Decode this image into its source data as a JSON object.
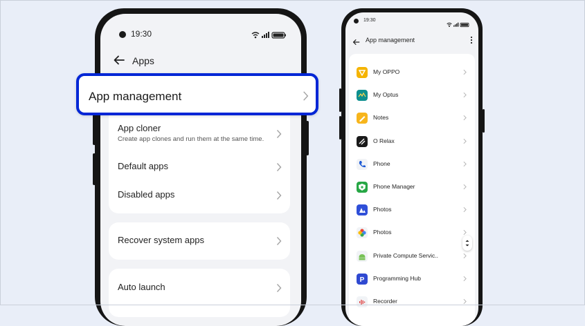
{
  "left_phone": {
    "status": {
      "time": "19:30"
    },
    "header": {
      "title": "Apps"
    },
    "highlighted_item": {
      "label": "App management"
    },
    "group1": [
      {
        "label": "App cloner",
        "sub": "Create app clones and run them at the same time."
      },
      {
        "label": "Default apps"
      },
      {
        "label": "Disabled apps"
      }
    ],
    "group2": [
      {
        "label": "Recover system apps"
      }
    ],
    "group3": [
      {
        "label": "Auto launch"
      }
    ]
  },
  "right_phone": {
    "status": {
      "time": "19:30"
    },
    "header": {
      "title": "App management"
    },
    "apps": [
      {
        "name": "My OPPO",
        "icon": "my-oppo-icon",
        "color": "#f5b400"
      },
      {
        "name": "My Optus",
        "icon": "my-optus-icon",
        "color": "#0d8f8f"
      },
      {
        "name": "Notes",
        "icon": "notes-icon",
        "color": "#f7b51c"
      },
      {
        "name": "O Relax",
        "icon": "o-relax-icon",
        "color": "#1a1a1a"
      },
      {
        "name": "Phone",
        "icon": "phone-icon",
        "color": "#1e5bd6"
      },
      {
        "name": "Phone Manager",
        "icon": "phone-manager-icon",
        "color": "#27a745"
      },
      {
        "name": "Photos",
        "icon": "photos-oppo-icon",
        "color": "#2f4fd8"
      },
      {
        "name": "Photos",
        "icon": "google-photos-icon",
        "color": "#ea4335"
      },
      {
        "name": "Private Compute Servic..",
        "icon": "android-icon",
        "color": "#78c257"
      },
      {
        "name": "Programming Hub",
        "icon": "programming-hub-icon",
        "color": "#2f49d1"
      },
      {
        "name": "Recorder",
        "icon": "recorder-icon",
        "color": "#e04040"
      }
    ]
  }
}
